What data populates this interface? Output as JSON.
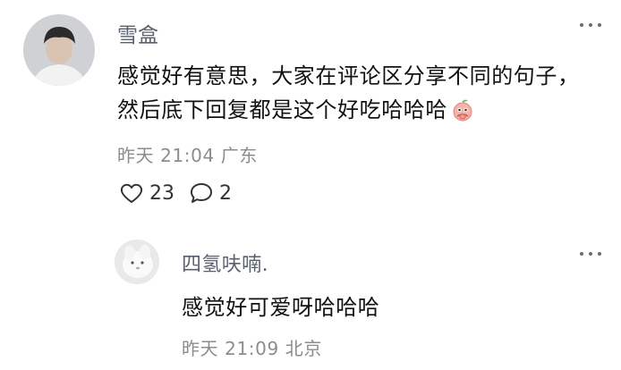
{
  "comment": {
    "author": "雪盒",
    "text": "感觉好有意思，大家在评论区分享不同的句子，然后底下回复都是这个好吃哈哈哈",
    "emoji_icon": "peach-face-emoji-icon",
    "time": "昨天 21:04",
    "location": "广东",
    "likes": "23",
    "comments": "2"
  },
  "reply": {
    "author": "四氢呋喃.",
    "text": "感觉好可爱呀哈哈哈",
    "time": "昨天 21:09",
    "location": "北京"
  },
  "colors": {
    "author": "#59606e",
    "meta": "#8c8c8c",
    "text": "#111111",
    "emoji": "#f29a8e"
  }
}
